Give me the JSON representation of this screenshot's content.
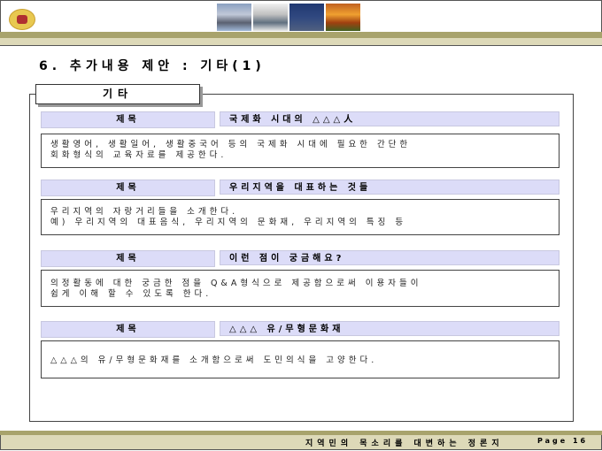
{
  "title": "6. 추가내용 제안 : 기타(1)",
  "tag": "기타",
  "sections": [
    {
      "label": "제목",
      "title": "국제화 시대의 △△△人",
      "lines": [
        "생활영어, 생활일어, 생활중국어 등의 국제화 시대에 필요한 간단한",
        "회화형식의 교육자료를 제공한다."
      ]
    },
    {
      "label": "제목",
      "title": "우리지역을 대표하는 것들",
      "lines": [
        "우리지역의 자랑거리들을 소개한다.",
        "예) 우리지역의 대표음식, 우리지역의 문화재, 우리지역의 특징 등"
      ]
    },
    {
      "label": "제목",
      "title": "이런 점이 궁금해요?",
      "lines": [
        "의정활동에 대한 궁금한 점을 Q&A형식으로 제공함으로써 이용자들이",
        "쉽게 이해 할 수 있도록 한다."
      ]
    },
    {
      "label": "제목",
      "title": "△△△ 유/무형문화재",
      "lines": [
        "△△△의 유/무형문화재를 소개함으로써 도민의식을 고양한다."
      ]
    }
  ],
  "footer": {
    "slogan": "지역민의 목소리를 대변하는 정론지",
    "page": "Page 16"
  }
}
